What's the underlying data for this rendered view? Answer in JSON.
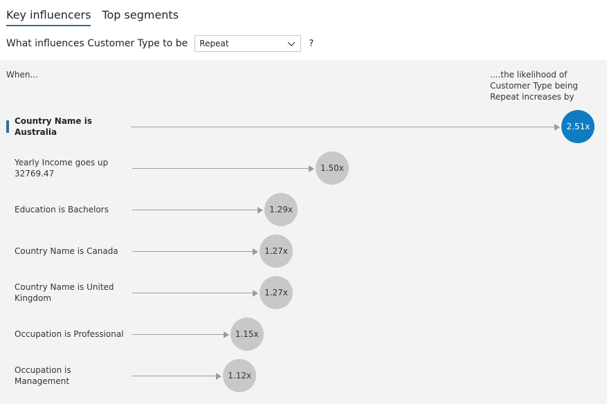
{
  "tabs": [
    {
      "label": "Key influencers",
      "active": true
    },
    {
      "label": "Top segments",
      "active": false
    }
  ],
  "question": {
    "label": "What influences Customer Type to be",
    "selected_value": "Repeat",
    "help": "?"
  },
  "panel": {
    "when_label": "When...",
    "likelihood_label": "....the likelihood of Customer Type being Repeat increases by"
  },
  "colors": {
    "accent": "#0f7bc0",
    "bubble": "#c8c8c8",
    "panel_bg": "#f3f3f3",
    "tab_underline": "#2b6f9e"
  },
  "influencers": [
    {
      "label": "Country Name is Australia",
      "value": 2.51,
      "value_label": "2.51x",
      "selected": true
    },
    {
      "label": "Yearly Income goes up 32769.47",
      "value": 1.5,
      "value_label": "1.50x",
      "selected": false
    },
    {
      "label": "Education is Bachelors",
      "value": 1.29,
      "value_label": "1.29x",
      "selected": false
    },
    {
      "label": "Country Name is Canada",
      "value": 1.27,
      "value_label": "1.27x",
      "selected": false
    },
    {
      "label": "Country Name is United Kingdom",
      "value": 1.27,
      "value_label": "1.27x",
      "selected": false
    },
    {
      "label": "Occupation is Professional",
      "value": 1.15,
      "value_label": "1.15x",
      "selected": false
    },
    {
      "label": "Occupation is Management",
      "value": 1.12,
      "value_label": "1.12x",
      "selected": false
    }
  ]
}
